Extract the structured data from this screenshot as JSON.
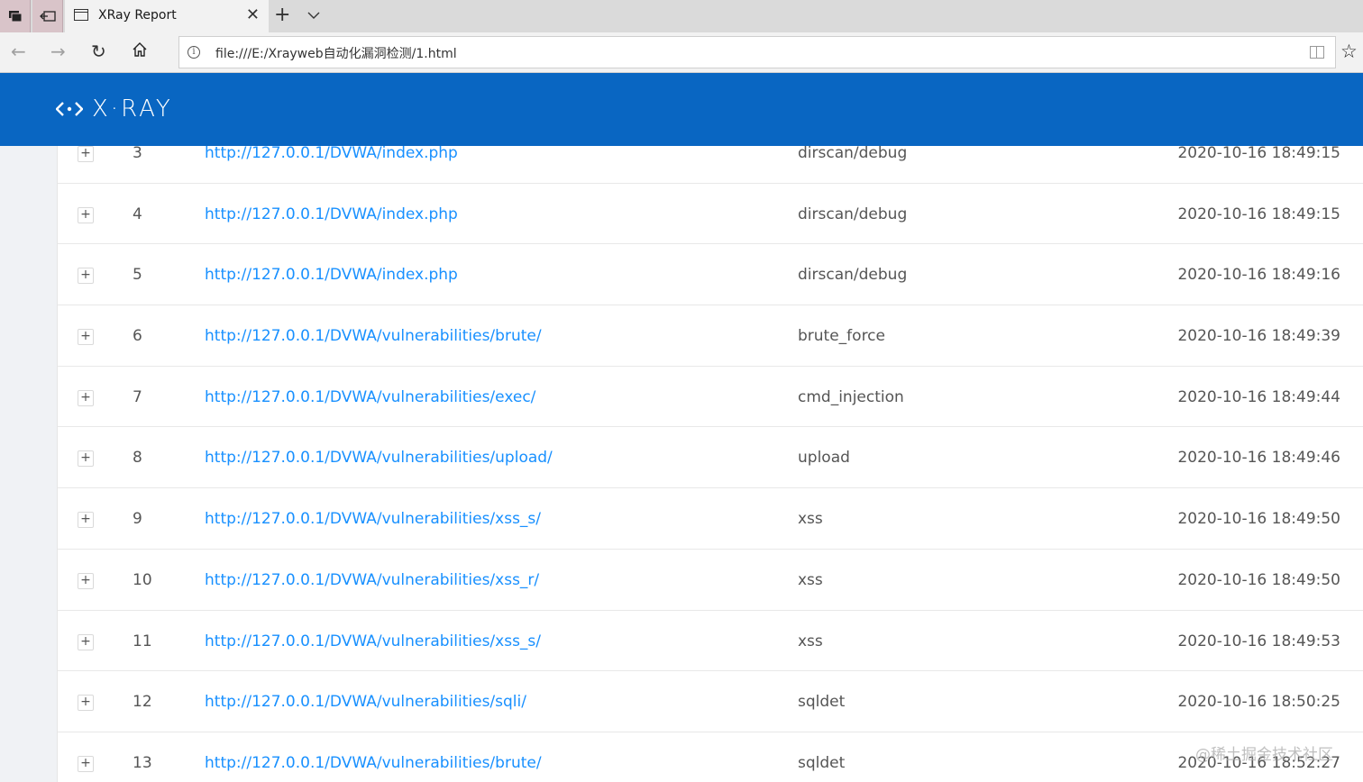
{
  "browser": {
    "tab_title": "XRay Report",
    "tab_close": "✕",
    "new_tab": "+",
    "tab_list": "⌄",
    "back": "←",
    "forward": "→",
    "refresh": "↻",
    "home": "⌂",
    "info": "i",
    "url": "file:///E:/Xrayweb自动化漏洞检测/1.html",
    "favorite": "☆"
  },
  "header": {
    "logo_text": "X·RAY",
    "background": "#0966c2"
  },
  "table": {
    "expand_symbol": "+",
    "rows": [
      {
        "id": "3",
        "url": "http://127.0.0.1/DVWA/index.php",
        "plugin": "dirscan/debug",
        "time": "2020-10-16 18:49:15"
      },
      {
        "id": "4",
        "url": "http://127.0.0.1/DVWA/index.php",
        "plugin": "dirscan/debug",
        "time": "2020-10-16 18:49:15"
      },
      {
        "id": "5",
        "url": "http://127.0.0.1/DVWA/index.php",
        "plugin": "dirscan/debug",
        "time": "2020-10-16 18:49:16"
      },
      {
        "id": "6",
        "url": "http://127.0.0.1/DVWA/vulnerabilities/brute/",
        "plugin": "brute_force",
        "time": "2020-10-16 18:49:39"
      },
      {
        "id": "7",
        "url": "http://127.0.0.1/DVWA/vulnerabilities/exec/",
        "plugin": "cmd_injection",
        "time": "2020-10-16 18:49:44"
      },
      {
        "id": "8",
        "url": "http://127.0.0.1/DVWA/vulnerabilities/upload/",
        "plugin": "upload",
        "time": "2020-10-16 18:49:46"
      },
      {
        "id": "9",
        "url": "http://127.0.0.1/DVWA/vulnerabilities/xss_s/",
        "plugin": "xss",
        "time": "2020-10-16 18:49:50"
      },
      {
        "id": "10",
        "url": "http://127.0.0.1/DVWA/vulnerabilities/xss_r/",
        "plugin": "xss",
        "time": "2020-10-16 18:49:50"
      },
      {
        "id": "11",
        "url": "http://127.0.0.1/DVWA/vulnerabilities/xss_s/",
        "plugin": "xss",
        "time": "2020-10-16 18:49:53"
      },
      {
        "id": "12",
        "url": "http://127.0.0.1/DVWA/vulnerabilities/sqli/",
        "plugin": "sqldet",
        "time": "2020-10-16 18:50:25"
      },
      {
        "id": "13",
        "url": "http://127.0.0.1/DVWA/vulnerabilities/brute/",
        "plugin": "sqldet",
        "time": "2020-10-16 18:52:27"
      }
    ]
  },
  "watermark": "@稀土掘金技术社区"
}
